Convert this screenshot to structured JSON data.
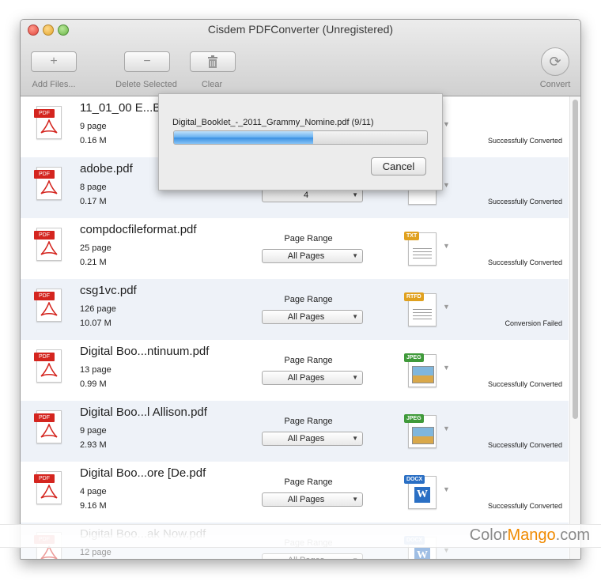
{
  "window": {
    "title": "Cisdem PDFConverter (Unregistered)"
  },
  "toolbar": {
    "add_label": "Add Files...",
    "delete_label": "Delete Selected",
    "clear_label": "Clear",
    "convert_label": "Convert"
  },
  "dialog": {
    "text": "Digital_Booklet_-_2011_Grammy_Nomine.pdf (9/11)",
    "progress": 0.55,
    "cancel_label": "Cancel"
  },
  "page_range_label": "Page Range",
  "files": [
    {
      "name": "11_01_00 E...Backup.pdf",
      "pages": "9 page",
      "size": "0.16 M",
      "range": "",
      "format": "",
      "status": "Successfully Converted"
    },
    {
      "name": "adobe.pdf",
      "pages": "8 page",
      "size": "0.17 M",
      "range": "4",
      "format": "",
      "status": "Successfully Converted"
    },
    {
      "name": "compdocfileformat.pdf",
      "pages": "25 page",
      "size": "0.21 M",
      "range": "All Pages",
      "format": "TXT",
      "status": "Successfully Converted"
    },
    {
      "name": "csg1vc.pdf",
      "pages": "126 page",
      "size": "10.07 M",
      "range": "All Pages",
      "format": "RTFD",
      "status": "Conversion Failed"
    },
    {
      "name": "Digital Boo...ntinuum.pdf",
      "pages": "13 page",
      "size": "0.99 M",
      "range": "All Pages",
      "format": "JPEG",
      "status": "Successfully Converted"
    },
    {
      "name": "Digital Boo...l Allison.pdf",
      "pages": "9 page",
      "size": "2.93 M",
      "range": "All Pages",
      "format": "JPEG",
      "status": "Successfully Converted"
    },
    {
      "name": "Digital Boo...ore [De.pdf",
      "pages": "4 page",
      "size": "9.16 M",
      "range": "All Pages",
      "format": "DOCX",
      "status": "Successfully Converted"
    },
    {
      "name": "Digital Boo...ak Now.pdf",
      "pages": "12 page",
      "size": "",
      "range": "All Pages",
      "format": "DOCX",
      "status": ""
    }
  ],
  "pdf_tag": "PDF",
  "watermark": {
    "part1": "Color",
    "part2": "Mango",
    "part3": ".com"
  },
  "colors": {
    "pdf_red": "#d4251f",
    "progress_blue": "#3a8fe2",
    "txt_tag": "#e0a11f",
    "rtfd_tag": "#e0a11f",
    "jpeg_tag": "#3f9a3a",
    "docx_tag": "#2a6fc4"
  }
}
